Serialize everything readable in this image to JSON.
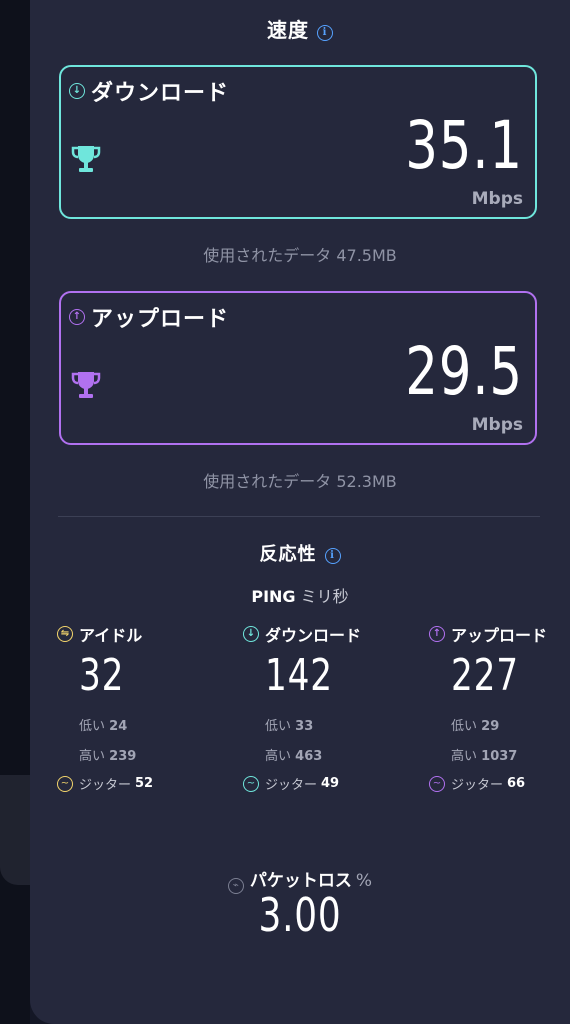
{
  "speed": {
    "title": "速度",
    "download": {
      "label": "ダウンロード",
      "value": "35.1",
      "unit": "Mbps",
      "data_used": "使用されたデータ 47.5MB"
    },
    "upload": {
      "label": "アップロード",
      "value": "29.5",
      "unit": "Mbps",
      "data_used": "使用されたデータ 52.3MB"
    }
  },
  "responsiveness": {
    "title": "反応性",
    "ping_label": "PING",
    "ping_unit": "ミリ秒",
    "columns": [
      {
        "label": "アイドル",
        "value": "32",
        "low_label": "低い",
        "low": "24",
        "high_label": "高い",
        "high": "239",
        "jitter_label": "ジッター",
        "jitter": "52"
      },
      {
        "label": "ダウンロード",
        "value": "142",
        "low_label": "低い",
        "low": "33",
        "high_label": "高い",
        "high": "463",
        "jitter_label": "ジッター",
        "jitter": "49"
      },
      {
        "label": "アップロード",
        "value": "227",
        "low_label": "低い",
        "low": "29",
        "high_label": "高い",
        "high": "1037",
        "jitter_label": "ジッター",
        "jitter": "66"
      }
    ]
  },
  "packet_loss": {
    "label": "パケットロス",
    "unit": "%",
    "value": "3.00"
  },
  "colors": {
    "download": "#6fe6dc",
    "upload": "#b171f0",
    "idle": "#f2d46b",
    "info": "#56a2ff",
    "panel": "#25283c"
  }
}
